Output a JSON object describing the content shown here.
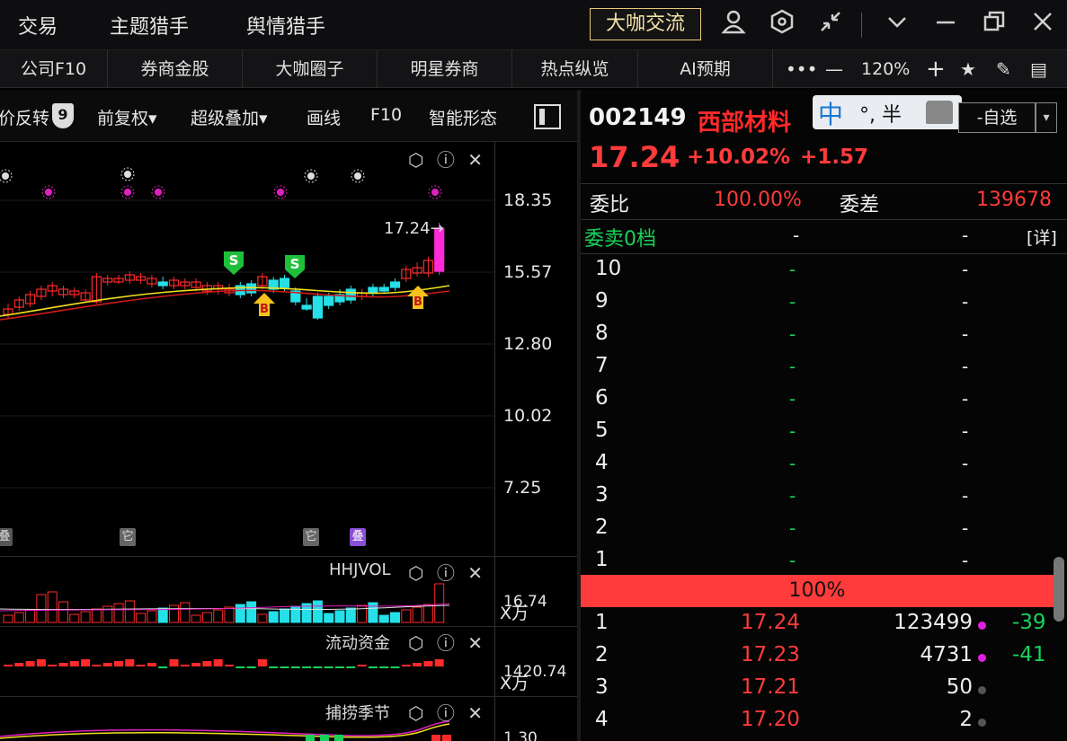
{
  "header": {
    "nav": [
      "交易",
      "主题猎手",
      "舆情猎手"
    ],
    "highlight_button": "大咖交流"
  },
  "tabs": [
    "公司F10",
    "券商金股",
    "大咖圈子",
    "明星券商",
    "热点纵览",
    "AI预期"
  ],
  "tab_tools": {
    "more": "•••",
    "zoom_out": "—",
    "zoom": "120%",
    "zoom_in": "+"
  },
  "chart_toolbar": {
    "items": [
      "价反转",
      "9",
      "前复权▾",
      "超级叠加▾",
      "画线",
      "F10",
      "智能形态"
    ]
  },
  "chart_data": {
    "type": "candlestick",
    "y_ticks": [
      "18.35",
      "15.57",
      "12.80",
      "10.02",
      "7.25"
    ],
    "last_price_label": "17.24",
    "markers": [
      {
        "kind": "S",
        "label": "S"
      },
      {
        "kind": "S",
        "label": "S"
      },
      {
        "kind": "B",
        "label": "B"
      },
      {
        "kind": "B",
        "label": "B"
      }
    ],
    "tags": [
      "叠",
      "它",
      "它",
      "叠"
    ],
    "subpanes": [
      {
        "name": "HHJVOL",
        "value": "16.74",
        "unit": "万"
      },
      {
        "name": "流动资金",
        "value": "1420.74",
        "unit": "万"
      },
      {
        "name": "捕捞季节",
        "value": "1.30"
      }
    ],
    "colors": {
      "up": "#ff2a2a",
      "down": "#25e0e8",
      "ma1": "#f2e01e",
      "ma2": "#d01a1a",
      "last": "#ff2ad8"
    }
  },
  "quote": {
    "code": "002149",
    "name": "西部材料",
    "price": "17.24",
    "change_pct": "+10.02%",
    "change": "+1.57",
    "watchlist": "-自选",
    "ime": {
      "mode": "中",
      "punct": "°, 半"
    }
  },
  "order_book": {
    "weibi_label": "委比",
    "weibi_value": "100.00%",
    "weicha_label": "委差",
    "weicha_value": "139678",
    "asks_label": "委卖0档",
    "dash": "-",
    "detail": "[详]",
    "ask_levels": [
      "10",
      "9",
      "8",
      "7",
      "6",
      "5",
      "4",
      "3",
      "2",
      "1"
    ],
    "ratio_bar": "100%",
    "bids": [
      {
        "level": "1",
        "price": "17.24",
        "volume": "123499",
        "change": "-39",
        "dot": "#e020e0"
      },
      {
        "level": "2",
        "price": "17.23",
        "volume": "4731",
        "change": "-41",
        "dot": "#e020e0"
      },
      {
        "level": "3",
        "price": "17.21",
        "volume": "50",
        "change": "",
        "dot": "#555"
      },
      {
        "level": "4",
        "price": "17.20",
        "volume": "2",
        "change": "",
        "dot": "#555"
      }
    ]
  }
}
